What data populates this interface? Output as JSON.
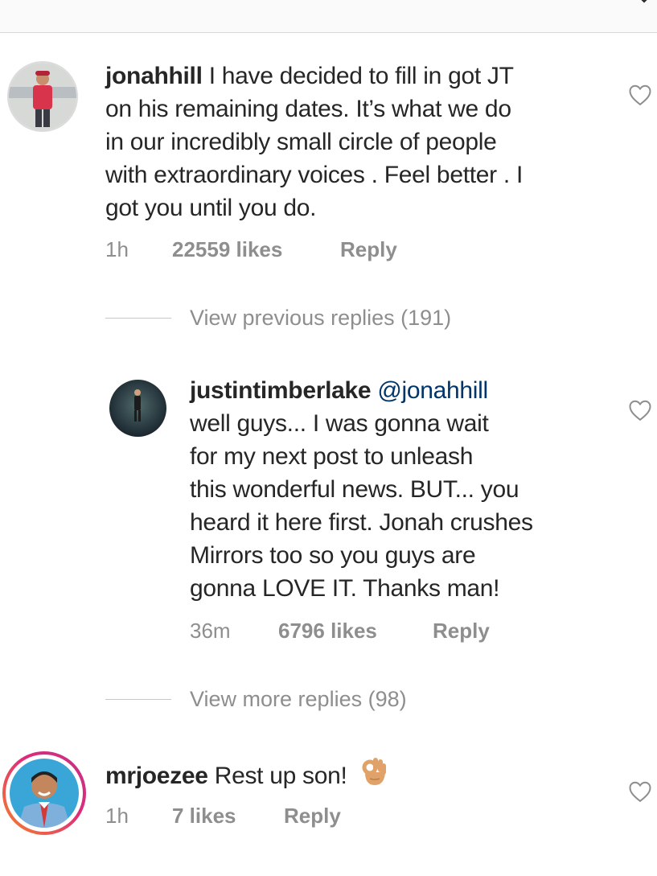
{
  "comments": [
    {
      "username": "jonahhill",
      "text": "I have decided to fill in got JT on his remaining dates. It’s what we do in our incredibly small circle of people with extraordinary voices . Feel better . I got you until you do.",
      "lines": [
        "I have decided to fill in got JT",
        "on his remaining dates. It’s what we do",
        "in our incredibly small circle of people",
        "with extraordinary voices . Feel better . I",
        "got you until you do."
      ],
      "time": "1h",
      "likes": "22559 likes",
      "reply": "Reply"
    },
    {
      "username": "justintimberlake",
      "mention": "@jonahhill",
      "lines": [
        "well guys... I was gonna wait",
        "for my next post to unleash",
        "this wonderful news. BUT... you",
        "heard it here first. Jonah crushes",
        "Mirrors too so you guys are",
        "gonna LOVE IT. Thanks man!"
      ],
      "time": "36m",
      "likes": "6796 likes",
      "reply": "Reply"
    },
    {
      "username": "mrjoezee",
      "text": "Rest up son!",
      "emoji": "ok-hand-emoji",
      "time": "1h",
      "likes": "7 likes",
      "reply": "Reply"
    }
  ],
  "view_previous": "View previous replies (191)",
  "view_more": "View more replies (98)",
  "icons": {
    "heart": "heart-outline-icon",
    "chevron": "chevron-down-icon"
  },
  "colors": {
    "text": "#262626",
    "secondary": "#8e8e8e",
    "mention": "#003569",
    "story_ring_start": "#f58529",
    "story_ring_end": "#dd2a7b"
  }
}
